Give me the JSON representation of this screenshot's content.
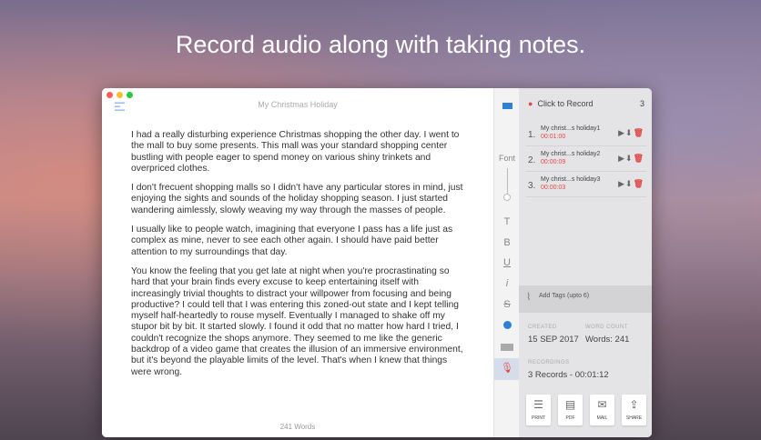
{
  "headline": "Record audio along with taking notes.",
  "editor": {
    "title": "My Christmas Holiday",
    "paragraphs": [
      "I had a really disturbing experience Christmas shopping the other day. I went to the mall to buy some presents. This mall was your standard shopping center bustling with people eager to spend money on various shiny trinkets and overpriced clothes.",
      "I don't frecuent shopping malls so I didn't have any particular stores in mind, just enjoying the sights and sounds of the holiday shopping season. I just started wandering aimlessly, slowly weaving my way through the masses of people.",
      "I usually like to people watch, imagining that everyone I pass has a life just as complex as mine, never to see each other again. I should have paid better attention to my surroundings that day.",
      "You know the feeling that you get late at night when you're procrastinating so hard that your brain finds every excuse to keep entertaining itself with increasingly trivial thoughts to distract your willpower from focusing and being productive? I could tell that I was entering this zoned-out state and I kept telling myself half-heartedly to rouse myself. Eventually I managed to shake off my stupor bit by bit. It started slowly. I found it odd that no matter how hard I tried, I couldn't recognize the shops anymore. They seemed to me like the generic backdrop of a video game that creates the illusion of an immersive environment, but it's beyond the playable limits of the level. That's when I knew that things were wrong."
    ],
    "word_count": "241 Words"
  },
  "toolbar": {
    "font": "Font",
    "text": "T",
    "bold": "B",
    "underline": "U",
    "italic": "i",
    "strike": "S",
    "accent": "#2f7fd6"
  },
  "panel": {
    "record_label": "Click to Record",
    "record_count": "3",
    "recordings": [
      {
        "num": "1.",
        "title": "My christ...s holiday1",
        "dur": "00:01:00"
      },
      {
        "num": "2.",
        "title": "My christ...s holiday2",
        "dur": "00:00:09"
      },
      {
        "num": "3.",
        "title": "My christ...s holiday3",
        "dur": "00:00:03"
      }
    ],
    "tags": "Add Tags (upto 6)",
    "created_label": "CREATED",
    "created": "15 SEP 2017",
    "wc_label": "WORD COUNT",
    "wc": "Words: 241",
    "rec_label": "RECORDINGS",
    "rec_summary": "3 Records - 00:01:12",
    "buttons": [
      {
        "label": "PRINT",
        "icon": "☰"
      },
      {
        "label": "PDF",
        "icon": "▤"
      },
      {
        "label": "MAIL",
        "icon": "✉"
      },
      {
        "label": "SHARE",
        "icon": "⇪"
      }
    ]
  }
}
